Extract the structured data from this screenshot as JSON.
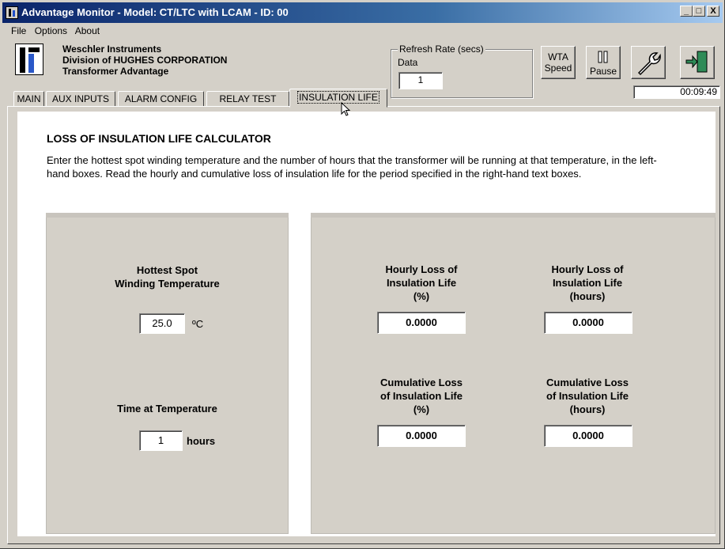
{
  "window": {
    "title": "Advantage Monitor - Model: CT/LTC with LCAM - ID: 00",
    "minimize": "_",
    "maximize": "□",
    "close": "X"
  },
  "menu": [
    "File",
    "Options",
    "About"
  ],
  "company": {
    "line1": "Weschler Instruments",
    "line2": "Division of HUGHES CORPORATION",
    "line3": "Transformer Advantage"
  },
  "refresh": {
    "legend": "Refresh Rate (secs)",
    "label": "Data",
    "value": "1"
  },
  "toolbar": {
    "wta_line1": "WTA",
    "wta_line2": "Speed",
    "pause_label": "Pause",
    "clock": "00:09:49"
  },
  "tabs": [
    "MAIN",
    "AUX INPUTS",
    "ALARM CONFIG",
    "RELAY TEST",
    "INSULATION LIFE"
  ],
  "calculator": {
    "heading": "LOSS OF INSULATION LIFE CALCULATOR",
    "instructions": "Enter the hottest spot winding temperature and the number of hours that the transformer will be running at that temperature, in the left-hand boxes. Read the hourly and cumulative loss of insulation life for the period specified in the right-hand text boxes.",
    "hottest_spot_label_1": "Hottest Spot",
    "hottest_spot_label_2": "Winding Temperature",
    "temperature_value": "25.0",
    "temperature_unit": "ºC",
    "time_label": "Time at Temperature",
    "time_value": "1",
    "time_unit": "hours",
    "hourly_pct_label_1": "Hourly Loss of",
    "hourly_pct_label_2": "Insulation Life",
    "hourly_pct_label_3": "(%)",
    "hourly_pct_value": "0.0000",
    "hourly_hrs_label_1": "Hourly Loss of",
    "hourly_hrs_label_2": "Insulation Life",
    "hourly_hrs_label_3": "(hours)",
    "hourly_hrs_value": "0.0000",
    "cum_pct_label_1": "Cumulative Loss",
    "cum_pct_label_2": "of Insulation Life",
    "cum_pct_label_3": "(%)",
    "cum_pct_value": "0.0000",
    "cum_hrs_label_1": "Cumulative Loss",
    "cum_hrs_label_2": "of Insulation Life",
    "cum_hrs_label_3": "(hours)",
    "cum_hrs_value": "0.0000"
  }
}
